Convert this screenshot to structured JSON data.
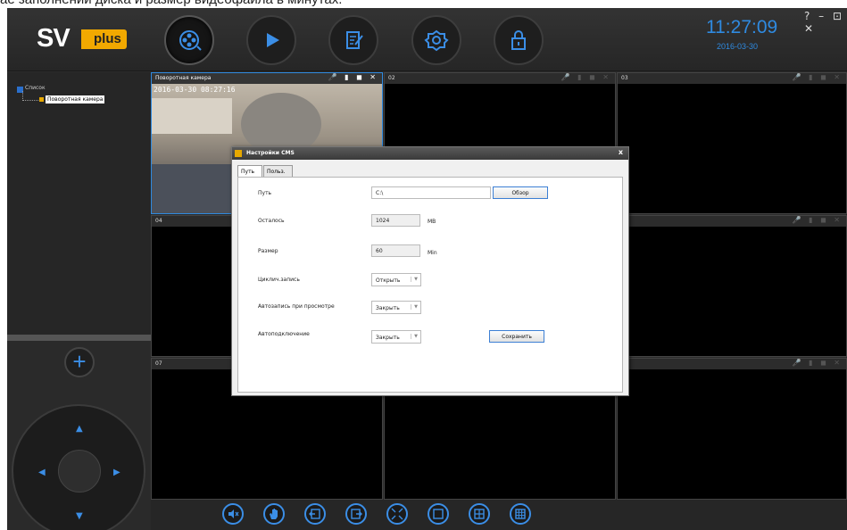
{
  "caption": "ae заполнении диска и размер видеофайла в минутах.",
  "header": {
    "logo_text": "SV",
    "logo_plus": "plus",
    "clock": "11:27:09",
    "date": "2016-03-30",
    "window_controls": "? – ⊡ ✕",
    "nav_icons": [
      "reel-icon",
      "play-icon",
      "edit-icon",
      "settings-icon",
      "lock-icon"
    ]
  },
  "sidebar": {
    "tree_root": "Список",
    "tree_camera": "Поворотная камера",
    "add_symbol": "+"
  },
  "grid": {
    "cells": [
      {
        "label": "Поворотная камера",
        "osd": "2016-03-30  08:27:16"
      },
      {
        "label": "02"
      },
      {
        "label": "03"
      },
      {
        "label": "04"
      },
      {
        "label": ""
      },
      {
        "label": ""
      },
      {
        "label": "07"
      },
      {
        "label": ""
      },
      {
        "label": ""
      }
    ]
  },
  "dialog": {
    "title": "Настройки CMS",
    "close": "x",
    "tabs": [
      "Путь",
      "Польз."
    ],
    "path_label": "Путь",
    "path_value": "C:\\",
    "browse_button": "Обзор",
    "remaining_label": "Осталось",
    "remaining_value": "1024",
    "remaining_unit": "MB",
    "size_label": "Размер",
    "size_value": "60",
    "size_unit": "Min",
    "loop_label": "Циклич.запись",
    "loop_value": "Открыть",
    "autorec_label": "Автозапись при просмотре",
    "autorec_value": "Закрыть",
    "autoconnect_label": "Автоподключение",
    "autoconnect_value": "Закрыть",
    "save_button": "Сохранить"
  },
  "bottom_toolbar": [
    "mute-icon",
    "hand-icon",
    "prev-icon",
    "next-icon",
    "fullscreen-icon",
    "single-view-icon",
    "four-view-icon",
    "nine-view-icon"
  ],
  "colors": {
    "accent": "#2f8ae0",
    "brand": "#f2a900",
    "background": "#2b2b2b"
  }
}
